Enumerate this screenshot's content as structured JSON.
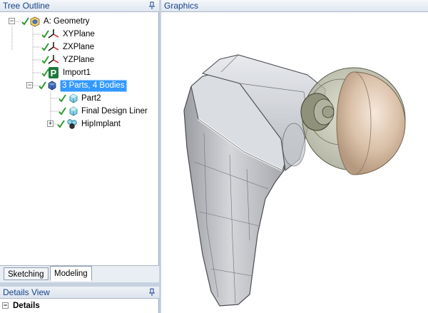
{
  "tree_outline": {
    "title": "Tree Outline",
    "nodes": [
      {
        "label": "A: Geometry",
        "expander": "−"
      },
      {
        "label": "XYPlane"
      },
      {
        "label": "ZXPlane"
      },
      {
        "label": "YZPlane"
      },
      {
        "label": "Import1"
      },
      {
        "label": "3 Parts, 4 Bodies",
        "expander": "−",
        "selected": true
      },
      {
        "label": "Part2"
      },
      {
        "label": "Final Design Liner"
      },
      {
        "label": "HipImplant",
        "expander": "+"
      }
    ]
  },
  "tabs": [
    {
      "label": "Sketching",
      "active": false
    },
    {
      "label": "Modeling",
      "active": true
    }
  ],
  "details_view": {
    "title": "Details View",
    "row_label": "Details",
    "row_expander": "−"
  },
  "graphics": {
    "title": "Graphics"
  },
  "colors": {
    "selection": "#3399ff",
    "header_text": "#15428b",
    "check_green": "#2e9b2e"
  },
  "icons": {
    "pin": "pin-icon",
    "geometry": "geometry-icon",
    "plane": "plane-axes-icon",
    "import": "import-feature-icon",
    "parts": "parts-bodies-icon",
    "body": "solid-body-icon",
    "multibody": "multi-body-part-icon",
    "check": "checkmark-icon"
  }
}
